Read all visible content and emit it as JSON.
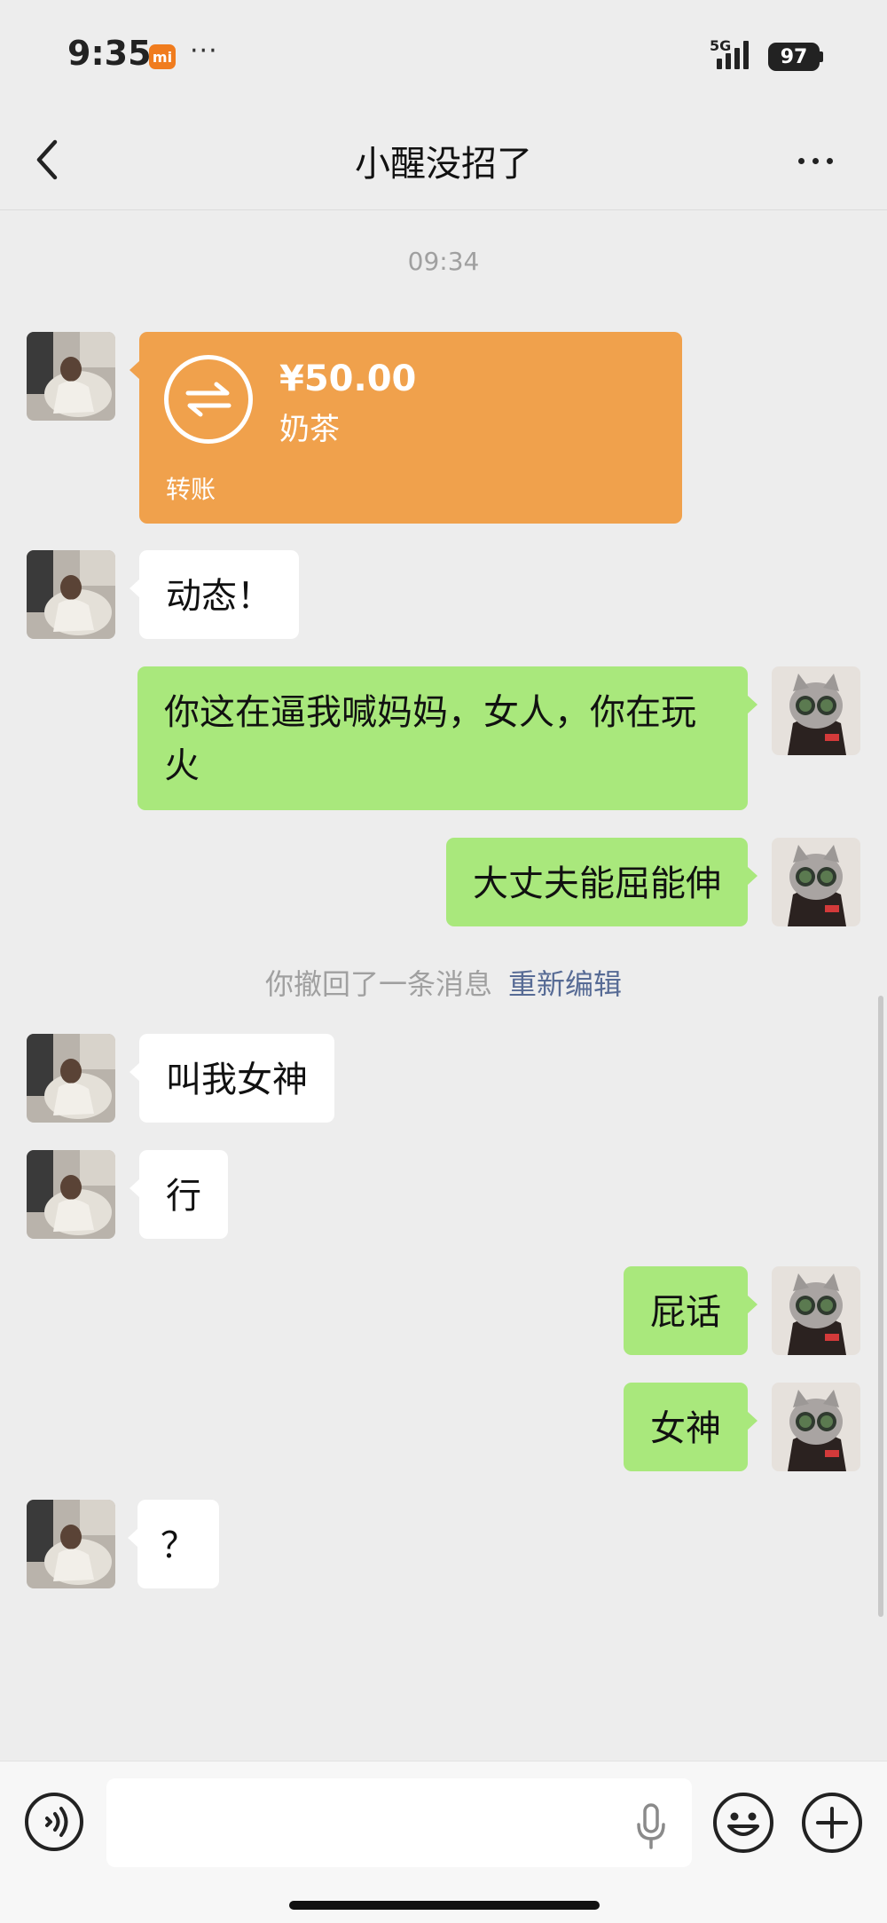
{
  "status_bar": {
    "time": "9:35",
    "mi_badge": "mi",
    "more": "···",
    "network": "5G",
    "battery": "97"
  },
  "header": {
    "title": "小醒没招了",
    "back_icon": "chevron-left-icon",
    "more_icon": "more-horizontal-icon"
  },
  "chat": {
    "timestamp": "09:34",
    "transfer": {
      "amount": "¥50.00",
      "note": "奶茶",
      "label": "转账",
      "icon": "transfer-arrows-icon",
      "color": "#f0a14c"
    },
    "messages": [
      {
        "side": "left",
        "text": "动态！"
      },
      {
        "side": "right",
        "text": "你这在逼我喊妈妈，女人，你在玩火"
      },
      {
        "side": "right",
        "text": "大丈夫能屈能伸"
      },
      {
        "side": "left",
        "text": "叫我女神"
      },
      {
        "side": "left",
        "text": "行"
      },
      {
        "side": "right",
        "text": "屁话"
      },
      {
        "side": "right",
        "text": "女神"
      },
      {
        "side": "left",
        "text": "？"
      }
    ],
    "recall_notice": {
      "text": "你撤回了一条消息",
      "link": "重新编辑"
    }
  },
  "input_bar": {
    "voice_icon": "voice-mode-icon",
    "mic_icon": "microphone-icon",
    "emoji_icon": "emoji-icon",
    "plus_icon": "plus-circle-icon",
    "placeholder": ""
  },
  "colors": {
    "background": "#ededed",
    "sent_bubble": "#a9e87c",
    "received_bubble": "#ffffff",
    "link": "#576b95",
    "muted": "#a0a0a0"
  }
}
